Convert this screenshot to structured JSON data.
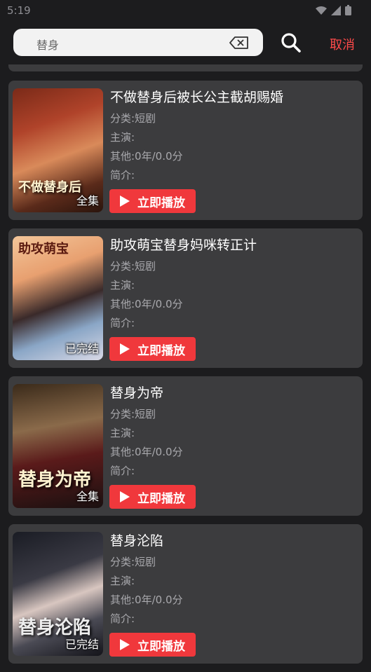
{
  "status": {
    "time": "5:19"
  },
  "search": {
    "query": "替身",
    "cancel_label": "取消"
  },
  "cards": [
    {
      "title": "不做替身后被长公主截胡赐婚",
      "category": "分类:短剧",
      "cast": "主演:",
      "other": "其他:0年/0.0分",
      "intro": "简介:",
      "badge": "全集",
      "poster_text": "不做替身后",
      "play_label": "立即播放"
    },
    {
      "title": "助攻萌宝替身妈咪转正计",
      "category": "分类:短剧",
      "cast": "主演:",
      "other": "其他:0年/0.0分",
      "intro": "简介:",
      "badge": "已完结",
      "poster_text": "助攻萌宝",
      "play_label": "立即播放"
    },
    {
      "title": "替身为帝",
      "category": "分类:短剧",
      "cast": "主演:",
      "other": "其他:0年/0.0分",
      "intro": "简介:",
      "badge": "全集",
      "poster_text": "替身为帝",
      "play_label": "立即播放"
    },
    {
      "title": "替身沦陷",
      "category": "分类:短剧",
      "cast": "主演:",
      "other": "其他:0年/0.0分",
      "intro": "简介:",
      "badge": "已完结",
      "poster_text": "替身沦陷",
      "play_label": "立即播放"
    }
  ],
  "colors": {
    "accent": "#f0383c",
    "cancel": "#ff4a4a",
    "card_bg": "#3c3c3e"
  }
}
